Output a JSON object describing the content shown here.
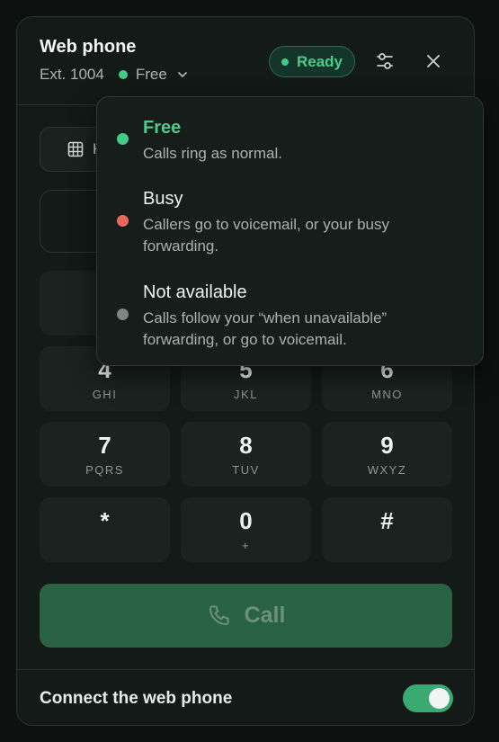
{
  "header": {
    "title": "Web phone",
    "extension": "Ext. 1004",
    "status": "Free",
    "ready_badge": "Ready"
  },
  "tab": {
    "label": "K"
  },
  "keypad": [
    {
      "digit": "4",
      "letters": "GHI"
    },
    {
      "digit": "5",
      "letters": "JKL"
    },
    {
      "digit": "6",
      "letters": "MNO"
    },
    {
      "digit": "7",
      "letters": "PQRS"
    },
    {
      "digit": "8",
      "letters": "TUV"
    },
    {
      "digit": "9",
      "letters": "WXYZ"
    },
    {
      "digit": "*",
      "letters": ""
    },
    {
      "digit": "0",
      "letters": "+"
    },
    {
      "digit": "#",
      "letters": ""
    }
  ],
  "call_button": {
    "label": "Call"
  },
  "footer": {
    "label": "Connect the web phone",
    "toggle_on": true
  },
  "status_menu": {
    "options": [
      {
        "title": "Free",
        "description": "Calls ring as normal."
      },
      {
        "title": "Busy",
        "description": "Callers go to voicemail, or your busy forwarding."
      },
      {
        "title": "Not available",
        "description": "Calls follow your “when unavailable” forwarding, or go to voicemail."
      }
    ]
  },
  "colors": {
    "free": "#43c988",
    "busy": "#e8675e",
    "not_available": "#7c8682",
    "accent": "#3aaa72"
  },
  "icons": {
    "settings": "sliders-icon",
    "close": "close-icon",
    "chevron": "chevron-down-icon",
    "tab": "grid-icon",
    "call": "phone-icon"
  }
}
